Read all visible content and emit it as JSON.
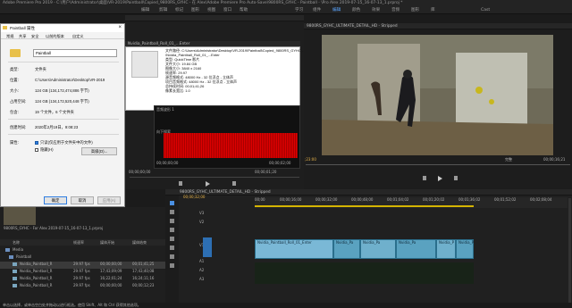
{
  "app": {
    "title": "Adobe Premiere Pro 2019 - C:\\用户\\Administrator\\桌面\\VR-2019\\Paintball\\Copied_9800RS_GYHC - 在 Alex\\Adobe Premiere Pro Auto-Save\\9800RS_GYHC - Paintball - \\Pro Alex 2019-07-15_16-07-13_1.prproj *"
  },
  "menu": {
    "items": [
      "编辑",
      "剪辑",
      "标记",
      "图形",
      "视图",
      "窗口",
      "帮助",
      "学习",
      "组件",
      "编辑",
      "颜色",
      "效果",
      "音频",
      "图形",
      "库",
      "Cast"
    ],
    "active": "编辑"
  },
  "dialog": {
    "title": "Paintball 属性",
    "tabs": [
      "常规",
      "共享",
      "安全",
      "以前的版本",
      "自定义"
    ],
    "name_value": "Paintball",
    "rows": [
      {
        "label": "类型:",
        "value": "文件夹"
      },
      {
        "label": "位置:",
        "value": "C:\\Users\\Administrator\\Desktop\\VR-2019"
      },
      {
        "label": "大小:",
        "value": "124 GB (134,172,474,886 字节)"
      },
      {
        "label": "占用空间:",
        "value": "124 GB (134,172,520,448 字节)"
      },
      {
        "label": "包含:",
        "value": "19 个文件，6 个文件夹"
      },
      {
        "label": "创建时间:",
        "value": "2020年2月19日，9:08:23"
      },
      {
        "label": "属性:",
        "value": "只读(仅应用于文件夹中的文件)"
      },
      {
        "label": "",
        "value": "隐藏(H)"
      }
    ],
    "advanced_label": "高级(D)...",
    "ok_label": "确定",
    "cancel_label": "取消",
    "apply_label": "应用(A)"
  },
  "info_panel": {
    "tab": "Nvidia_Paintball_Roll_01_...Enter",
    "lines": [
      "文件路径: C:\\Users\\Administrator\\Desktop\\VR-2019\\Paintball\\Copied_9800RS_GYHC - For Alex",
      "\\Nvidia_Paintball_Roll_01_...Enter",
      "类型: QuickTime 影片",
      "文件大小: 19.84 GB",
      "图像大小: 3840 x 2160",
      "帧速率: 29.97",
      "源音频格式: 48000 Hz - 32 位浮点 - 立体声",
      "项目音频格式: 48000 Hz - 32 位浮点 - 立体声",
      "总持续时间: 00;01;41;26",
      "像素长宽比: 1.0"
    ]
  },
  "audio_panel": {
    "title": "音频波形 1",
    "timecode_left": "00;00;00;00",
    "timecode_right": "00;00;02;00",
    "hint": "向下搜索"
  },
  "source_timecodes": {
    "start": "00;00;00;00",
    "mid": "00;00;01;20",
    "end": "00;00;02;00"
  },
  "program": {
    "tab": "9800RS_GYHC_ULTIMATE_DETAIL_HD - Stripped",
    "timecode": ";23:00",
    "zoom": "完整",
    "duration": "00;00;16;21"
  },
  "timeline": {
    "tab": "9800RS_GYHC_ULTIMATE_DETAIL_HD - Stripped",
    "timecode": "00;00;32;00",
    "ruler": [
      "00;00",
      "00;00;16;00",
      "00;00;32;00",
      "00;00;48;00",
      "00;01;04;02",
      "00;01;20;02",
      "00;01;36;02",
      "00;01;52;02",
      "00;02;08;04"
    ],
    "tracks": [
      "V3",
      "V2",
      "V1",
      "A1",
      "A2",
      "A3"
    ],
    "clip_labels": [
      "Nvidia_Paintball_Roll_01_Enter",
      "Nvidia_Pa",
      "Nvidia_Pa",
      "Nvidia_Pa",
      "Nvidia_P",
      "Nvidia_P"
    ]
  },
  "project": {
    "thumb_caption": "9800RS_GYHC - For Alex 2019-07-15_16-07-13_1.prproj",
    "headers": [
      "名称",
      "帧速率",
      "媒体开始",
      "媒体结束"
    ],
    "rows": [
      {
        "name": "Media",
        "fps": "",
        "start": "",
        "end": ""
      },
      {
        "name": "Paintball",
        "fps": "",
        "start": "",
        "end": ""
      },
      {
        "name": "Nvidia_Paintball_R",
        "fps": "29.97 fps",
        "start": "00;00;00;00",
        "end": "00;01;41;25"
      },
      {
        "name": "Nvidia_Paintball_R",
        "fps": "29.97 fps",
        "start": "17;43;09;09",
        "end": "17;43;40;08"
      },
      {
        "name": "Nvidia_Paintball_R",
        "fps": "29.97 fps",
        "start": "16;22;01;24",
        "end": "16;24;11;16"
      },
      {
        "name": "Nvidia_Paintball_R",
        "fps": "29.97 fps",
        "start": "00;00;00;00",
        "end": "00;00;12;23"
      }
    ]
  },
  "status": {
    "text": "单击以选择，或单击空白处并拖动以进行框选。使用 Shift、Alt 和 Ctrl 获得其他选项。"
  },
  "colors": {
    "accent": "#4a90e2",
    "audio_red": "#e00000",
    "clip_blue": "#3d8fb0",
    "clip_green": "#34c234"
  }
}
